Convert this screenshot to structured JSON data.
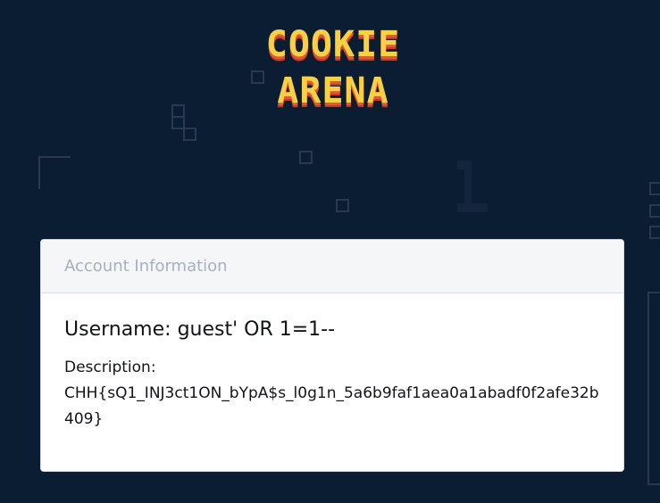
{
  "logo": {
    "line1": "COOKIE",
    "line2": "ARENA",
    "colors": {
      "fill": "#f7d046",
      "shadow": "#e2573a"
    }
  },
  "account_card": {
    "header_title": "Account Information",
    "username_label": "Username:",
    "username_value": "guest' OR 1=1--",
    "description_label": "Description:",
    "description_value": "CHH{sQ1_INJ3ct1ON_bYpA$s_l0g1n_5a6b9faf1aea0a1abadf0f2afe32b409}"
  },
  "colors": {
    "page_background": "#0b1d33",
    "card_background": "#ffffff",
    "card_header_background": "#f5f6f7",
    "header_text": "#a7b0bf"
  }
}
